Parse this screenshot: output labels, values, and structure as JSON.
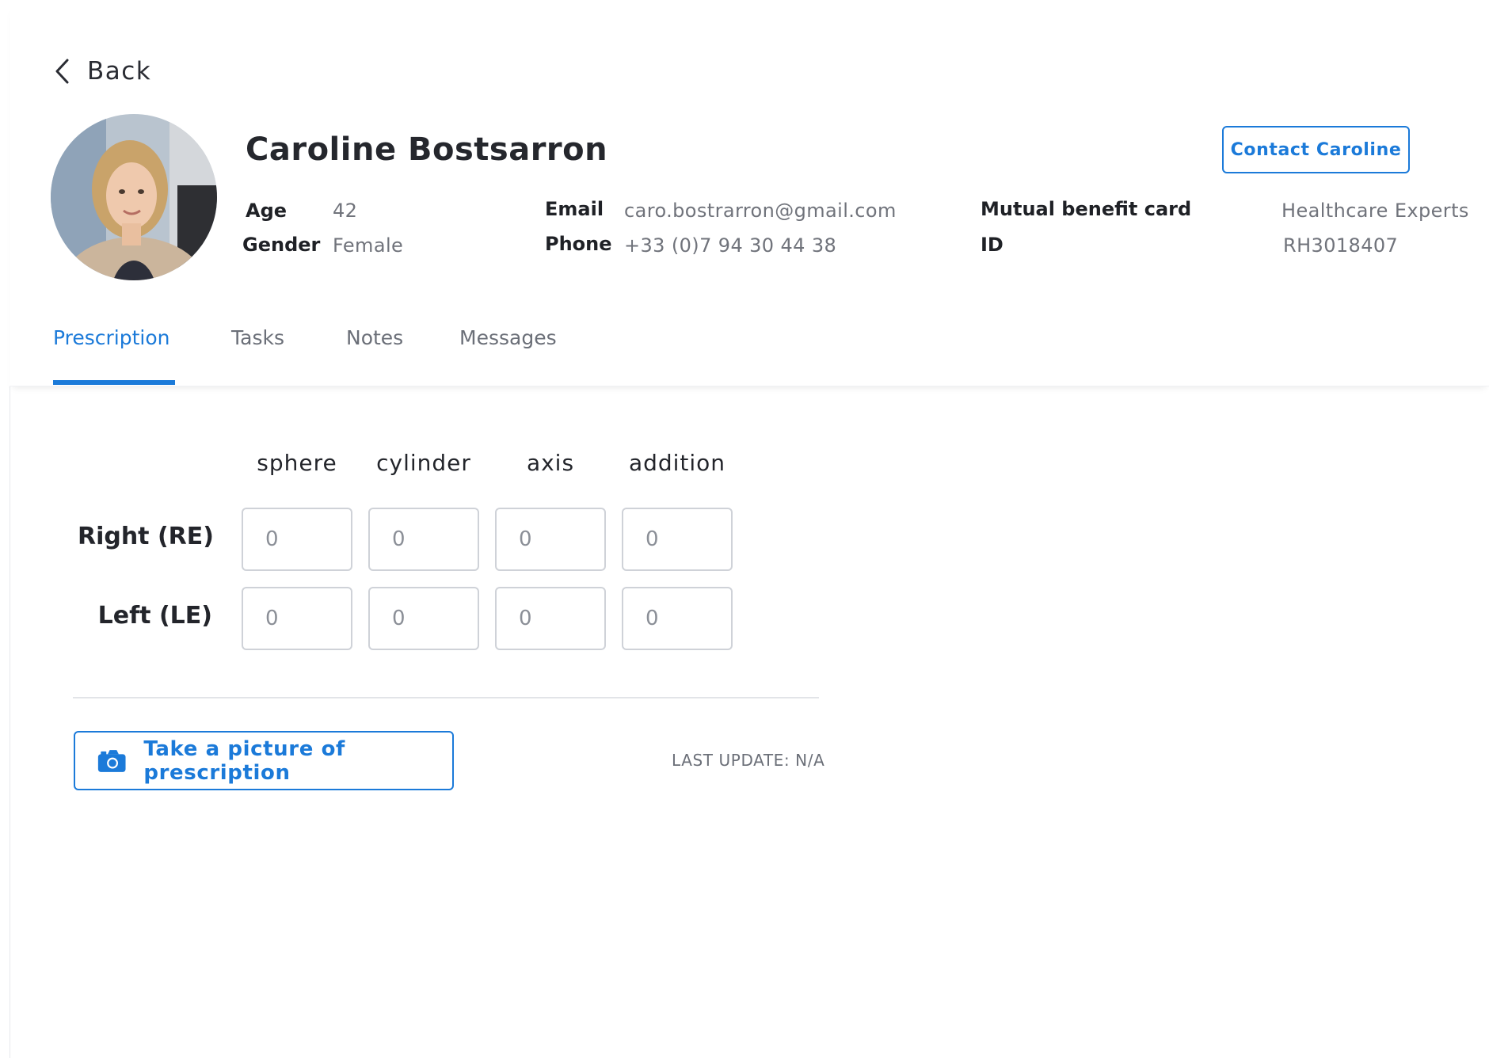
{
  "back": {
    "label": "Back"
  },
  "patient": {
    "name": "Caroline Bostsarron",
    "age_label": "Age",
    "age": "42",
    "gender_label": "Gender",
    "gender": "Female",
    "email_label": "Email",
    "email": "caro.bostrarron@gmail.com",
    "phone_label": "Phone",
    "phone": "+33 (0)7 94 30 44 38",
    "mutual_label": "Mutual benefit card",
    "mutual": "Healthcare Experts",
    "id_label": "ID",
    "id": "RH3018407"
  },
  "contact_button": "Contact Caroline",
  "tabs": [
    {
      "label": "Prescription",
      "active": true
    },
    {
      "label": "Tasks",
      "active": false
    },
    {
      "label": "Notes",
      "active": false
    },
    {
      "label": "Messages",
      "active": false
    }
  ],
  "prescription": {
    "columns": [
      "sphere",
      "cylinder",
      "axis",
      "addition"
    ],
    "rows": [
      {
        "label": "Right (RE)",
        "values": [
          "0",
          "0",
          "0",
          "0"
        ]
      },
      {
        "label": "Left (LE)",
        "values": [
          "0",
          "0",
          "0",
          "0"
        ]
      }
    ]
  },
  "picture_button": "Take a picture of prescription",
  "last_update": "LAST UPDATE: N/A",
  "colors": {
    "accent": "#1b7ad9",
    "border": "#cfd2d8",
    "muted": "#70737b"
  },
  "icons": {
    "back": "chevron-left-icon",
    "camera": "camera-icon"
  }
}
